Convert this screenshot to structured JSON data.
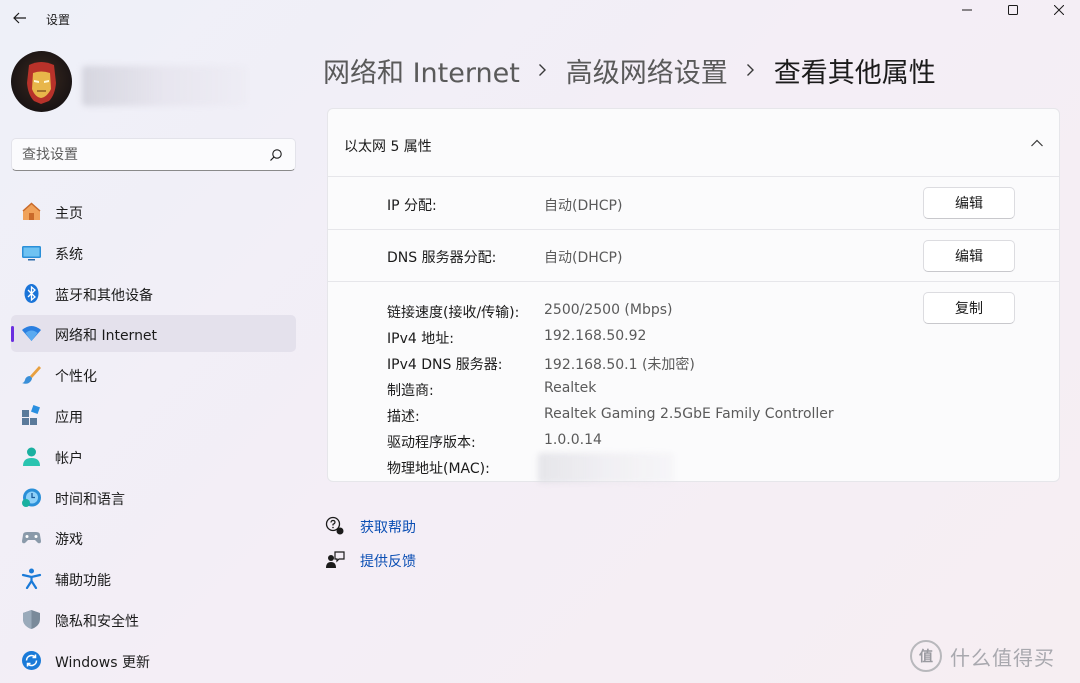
{
  "window": {
    "title": "设置"
  },
  "search": {
    "placeholder": "查找设置"
  },
  "sidebar": {
    "items": [
      {
        "label": "主页",
        "icon": "home-icon"
      },
      {
        "label": "系统",
        "icon": "system-icon"
      },
      {
        "label": "蓝牙和其他设备",
        "icon": "bluetooth-icon"
      },
      {
        "label": "网络和 Internet",
        "icon": "wifi-icon",
        "active": true
      },
      {
        "label": "个性化",
        "icon": "brush-icon"
      },
      {
        "label": "应用",
        "icon": "apps-icon"
      },
      {
        "label": "帐户",
        "icon": "account-icon"
      },
      {
        "label": "时间和语言",
        "icon": "globe-clock-icon"
      },
      {
        "label": "游戏",
        "icon": "gamepad-icon"
      },
      {
        "label": "辅助功能",
        "icon": "accessibility-icon"
      },
      {
        "label": "隐私和安全性",
        "icon": "shield-icon"
      },
      {
        "label": "Windows 更新",
        "icon": "update-icon"
      }
    ]
  },
  "breadcrumb": {
    "items": [
      "网络和 Internet",
      "高级网络设置",
      "查看其他属性"
    ]
  },
  "card": {
    "title": "以太网 5 属性",
    "ip_assignment": {
      "label": "IP 分配:",
      "value": "自动(DHCP)",
      "button": "编辑"
    },
    "dns_assignment": {
      "label": "DNS 服务器分配:",
      "value": "自动(DHCP)",
      "button": "编辑"
    },
    "copy_button": "复制",
    "properties": [
      {
        "label": "链接速度(接收/传输):",
        "value": "2500/2500 (Mbps)"
      },
      {
        "label": "IPv4 地址:",
        "value": "192.168.50.92"
      },
      {
        "label": "IPv4 DNS 服务器:",
        "value": "192.168.50.1 (未加密)"
      },
      {
        "label": "制造商:",
        "value": "Realtek"
      },
      {
        "label": "描述:",
        "value": "Realtek Gaming 2.5GbE Family Controller"
      },
      {
        "label": "驱动程序版本:",
        "value": "1.0.0.14"
      },
      {
        "label": "物理地址(MAC):",
        "value": ""
      }
    ]
  },
  "links": {
    "help": "获取帮助",
    "feedback": "提供反馈"
  },
  "watermark": {
    "logo": "值",
    "text": "什么值得买"
  },
  "colors": {
    "accent": "#6a2ee0",
    "link": "#0b4fb4"
  }
}
